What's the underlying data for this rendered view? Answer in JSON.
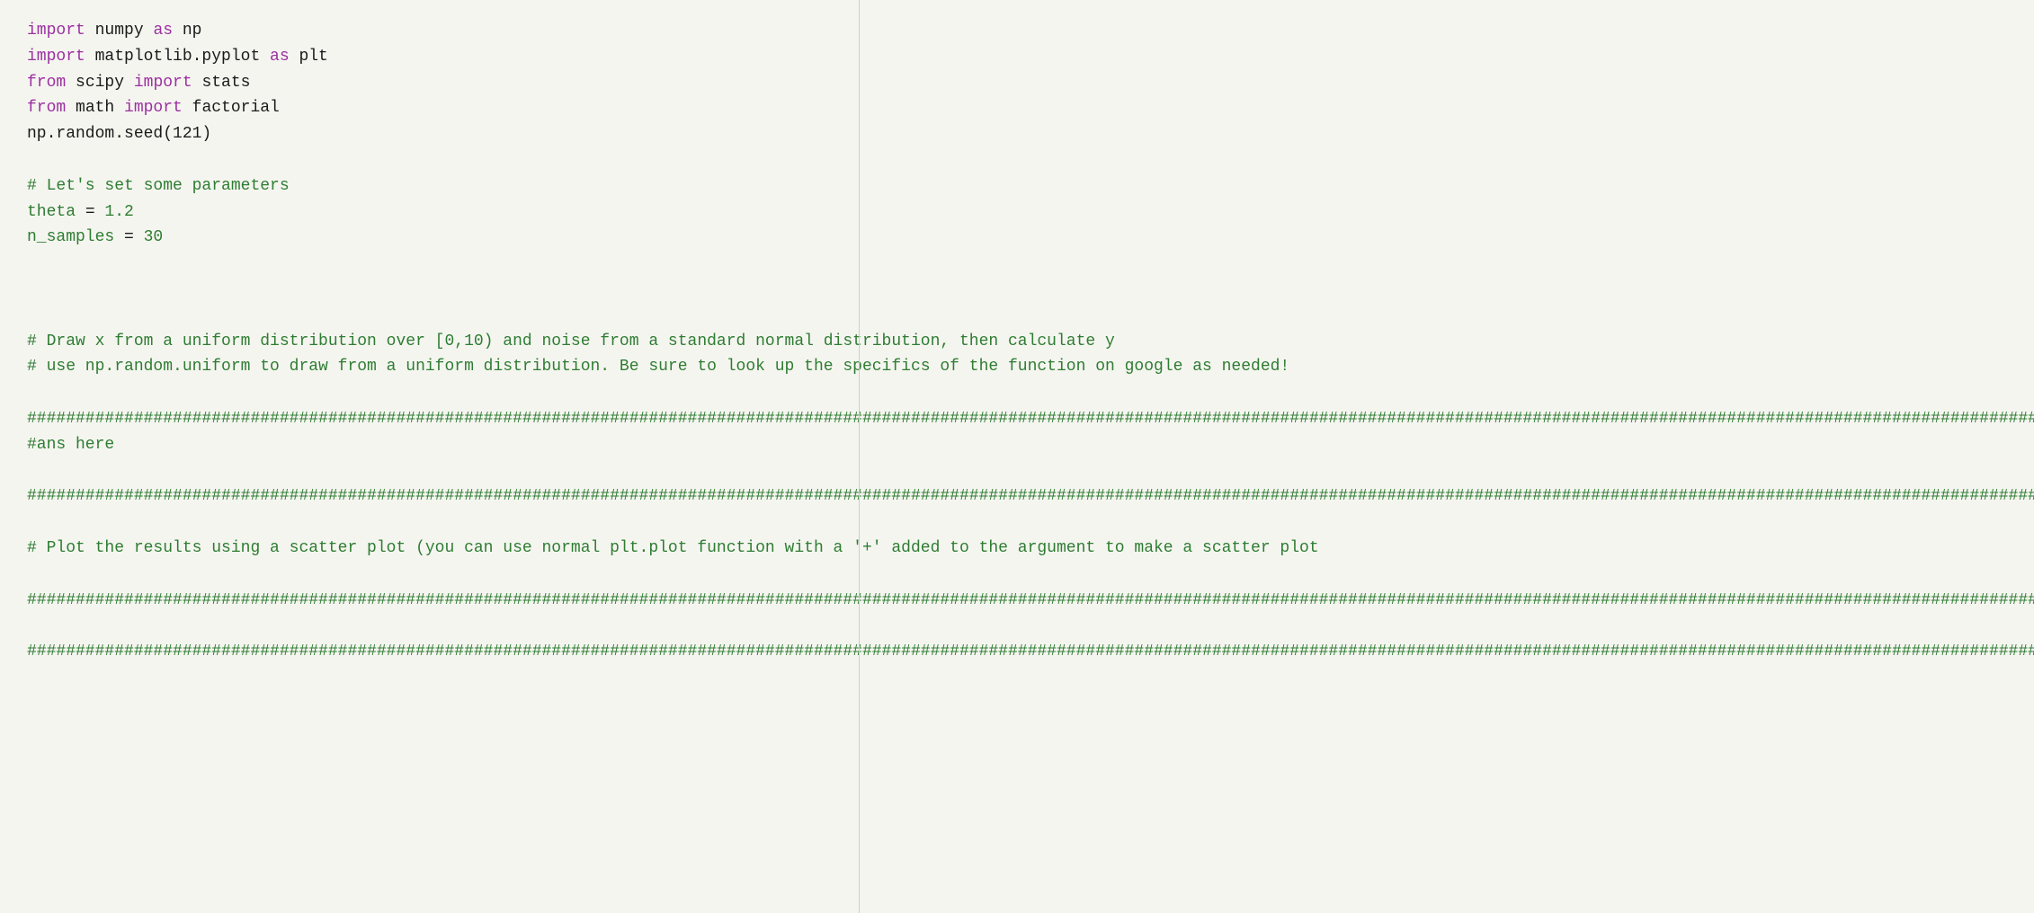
{
  "code": {
    "lines": [
      {
        "id": "line1",
        "parts": [
          {
            "type": "keyword-purple",
            "text": "import"
          },
          {
            "type": "text-default",
            "text": " numpy "
          },
          {
            "type": "keyword-purple",
            "text": "as"
          },
          {
            "type": "text-default",
            "text": " np"
          }
        ]
      },
      {
        "id": "line2",
        "parts": [
          {
            "type": "keyword-purple",
            "text": "import"
          },
          {
            "type": "text-default",
            "text": " matplotlib.pyplot "
          },
          {
            "type": "keyword-purple",
            "text": "as"
          },
          {
            "type": "text-default",
            "text": " plt"
          }
        ]
      },
      {
        "id": "line3",
        "parts": [
          {
            "type": "keyword-purple",
            "text": "from"
          },
          {
            "type": "text-default",
            "text": " scipy "
          },
          {
            "type": "keyword-purple",
            "text": "import"
          },
          {
            "type": "text-default",
            "text": " stats"
          }
        ]
      },
      {
        "id": "line4",
        "parts": [
          {
            "type": "keyword-purple",
            "text": "from"
          },
          {
            "type": "text-default",
            "text": " math "
          },
          {
            "type": "keyword-purple",
            "text": "import"
          },
          {
            "type": "text-default",
            "text": " factorial"
          }
        ]
      },
      {
        "id": "line5",
        "parts": [
          {
            "type": "text-default",
            "text": "np.random.seed(121)"
          }
        ]
      },
      {
        "id": "line6",
        "empty": true
      },
      {
        "id": "line7",
        "parts": [
          {
            "type": "comment",
            "text": "# Let's set some parameters"
          }
        ]
      },
      {
        "id": "line8",
        "parts": [
          {
            "type": "keyword-green",
            "text": "theta"
          },
          {
            "type": "text-default",
            "text": " = "
          },
          {
            "type": "keyword-green",
            "text": "1.2"
          }
        ]
      },
      {
        "id": "line9",
        "parts": [
          {
            "type": "keyword-green",
            "text": "n_samples"
          },
          {
            "type": "text-default",
            "text": " = "
          },
          {
            "type": "keyword-green",
            "text": "30"
          }
        ]
      },
      {
        "id": "line10",
        "empty": true
      },
      {
        "id": "line11",
        "empty": true
      },
      {
        "id": "line12",
        "empty": true
      },
      {
        "id": "line13",
        "parts": [
          {
            "type": "comment",
            "text": "# Draw x from a uniform distribution over [0,10) and noise from a standard normal distribution, then calculate y"
          }
        ]
      },
      {
        "id": "line14",
        "parts": [
          {
            "type": "comment",
            "text": "# use np.random.uniform to draw from a uniform distribution. Be sure to look up the specifics of the function on google as needed!"
          }
        ]
      },
      {
        "id": "line15",
        "empty": true
      },
      {
        "id": "line16",
        "parts": [
          {
            "type": "separator",
            "text": "##############################################################################################################################################################################"
          }
        ]
      },
      {
        "id": "line17",
        "parts": [
          {
            "type": "comment",
            "text": "#ans here"
          }
        ]
      },
      {
        "id": "line18",
        "empty": true
      },
      {
        "id": "line19",
        "parts": [
          {
            "type": "separator",
            "text": "##############################################################################################################################################################################"
          }
        ]
      },
      {
        "id": "line20",
        "empty": true
      },
      {
        "id": "line21",
        "parts": [
          {
            "type": "comment",
            "text": "# Plot the results using a scatter plot (you can use normal plt.plot function with a '+' added to the argument to make a scatter plot"
          }
        ]
      },
      {
        "id": "line22",
        "empty": true
      },
      {
        "id": "line23",
        "parts": [
          {
            "type": "separator",
            "text": "##############################################################################################################################################################################"
          }
        ]
      },
      {
        "id": "line24",
        "empty": true
      },
      {
        "id": "line25",
        "parts": [
          {
            "type": "separator",
            "text": "##############################################################################################################################################################################"
          }
        ]
      }
    ]
  }
}
